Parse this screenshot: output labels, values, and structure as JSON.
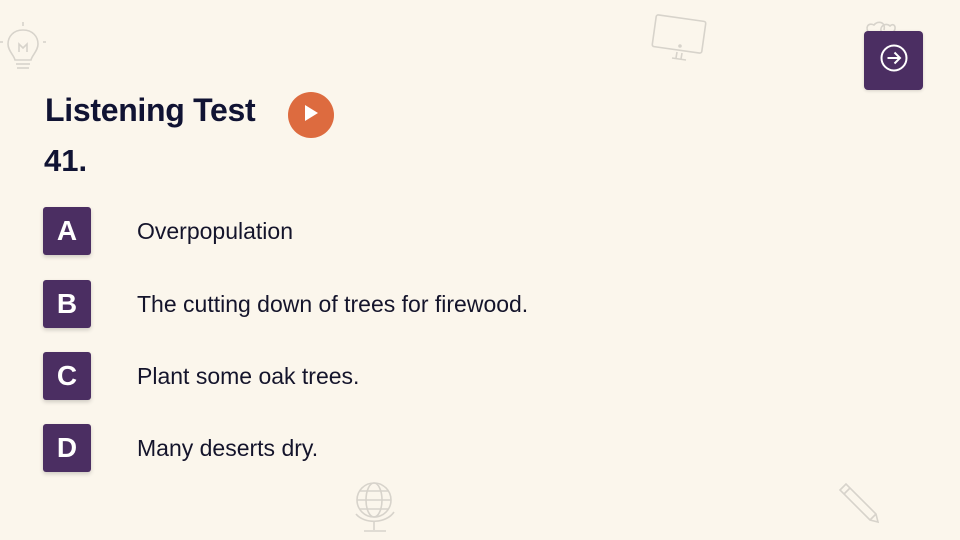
{
  "header": {
    "title": "Listening Test",
    "question_number": "41."
  },
  "options": [
    {
      "letter": "A",
      "text": "Overpopulation"
    },
    {
      "letter": "B",
      "text": "The cutting down of trees for firewood."
    },
    {
      "letter": "C",
      "text": "Plant some oak trees."
    },
    {
      "letter": "D",
      "text": "Many deserts dry."
    }
  ],
  "colors": {
    "background": "#fbf6ec",
    "accent_purple": "#4b2e62",
    "play_orange": "#dd6b3f",
    "text_dark": "#101333"
  },
  "icons": {
    "play": "play-icon",
    "next": "arrow-right-circle-icon",
    "decorations": [
      "lightbulb-icon",
      "monitor-icon",
      "globe-icon",
      "pencil-icon",
      "heart-icon"
    ]
  }
}
